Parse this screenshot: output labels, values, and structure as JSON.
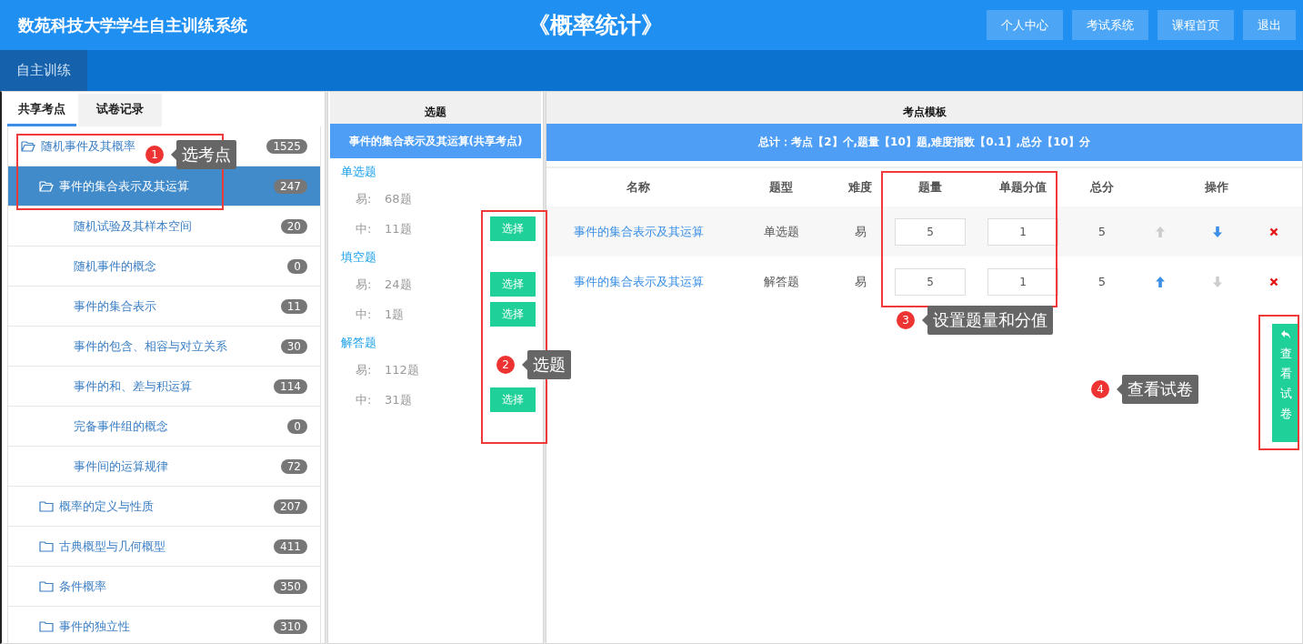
{
  "header": {
    "site_title": "数苑科技大学学生自主训练系统",
    "course_title": "《概率统计》",
    "buttons": [
      "个人中心",
      "考试系统",
      "课程首页",
      "退出"
    ]
  },
  "nav": {
    "items": [
      {
        "label": "自主训练",
        "selected": true
      }
    ]
  },
  "left_panel": {
    "tabs": [
      {
        "label": "共享考点",
        "selected": true
      },
      {
        "label": "试卷记录",
        "selected": false
      }
    ],
    "tree": [
      {
        "label": "随机事件及其概率",
        "count": "1525",
        "expanded": true,
        "selected": false,
        "children": [
          {
            "label": "事件的集合表示及其运算",
            "count": "247",
            "expanded": true,
            "selected": true,
            "children": [
              {
                "label": "随机试验及其样本空间",
                "count": "20",
                "selected": false
              },
              {
                "label": "随机事件的概念",
                "count": "0",
                "selected": false
              },
              {
                "label": "事件的集合表示",
                "count": "11",
                "selected": false
              },
              {
                "label": "事件的包含、相容与对立关系",
                "count": "30",
                "selected": false
              },
              {
                "label": "事件的和、差与积运算",
                "count": "114",
                "selected": false
              },
              {
                "label": "完备事件组的概念",
                "count": "0",
                "selected": false
              },
              {
                "label": "事件间的运算规律",
                "count": "72",
                "selected": false
              }
            ]
          },
          {
            "label": "概率的定义与性质",
            "count": "207",
            "expanded": false,
            "selected": false
          },
          {
            "label": "古典概型与几何概型",
            "count": "411",
            "expanded": false,
            "selected": false
          },
          {
            "label": "条件概率",
            "count": "350",
            "expanded": false,
            "selected": false
          },
          {
            "label": "事件的独立性",
            "count": "310",
            "expanded": false,
            "selected": false
          }
        ]
      }
    ]
  },
  "middle_panel": {
    "title": "选题",
    "subtitle": "事件的集合表示及其运算(共享考点)",
    "groups": [
      {
        "type": "单选题",
        "lines": [
          {
            "level": "易:",
            "count": "68题"
          },
          {
            "level": "中:",
            "count": "11题",
            "button": "选择"
          }
        ]
      },
      {
        "type": "填空题",
        "lines": [
          {
            "level": "易:",
            "count": "24题",
            "button": "选择"
          },
          {
            "level": "中:",
            "count": "1题",
            "button": "选择"
          }
        ]
      },
      {
        "type": "解答题",
        "lines": [
          {
            "level": "易:",
            "count": "112题"
          },
          {
            "level": "中:",
            "count": "31题",
            "button": "选择"
          }
        ]
      }
    ]
  },
  "right_panel": {
    "title": "考点模板",
    "summary": "总计：考点【2】个,题量【10】题,难度指数【0.1】,总分【10】分",
    "columns": [
      "名称",
      "题型",
      "难度",
      "题量",
      "单题分值",
      "总分",
      "操作"
    ],
    "rows": [
      {
        "name": "事件的集合表示及其运算",
        "type": "单选题",
        "difficulty": "易",
        "quantity": "5",
        "score": "1",
        "total": "5",
        "up_enabled": false,
        "down_enabled": true
      },
      {
        "name": "事件的集合表示及其运算",
        "type": "解答题",
        "difficulty": "易",
        "quantity": "5",
        "score": "1",
        "total": "5",
        "up_enabled": true,
        "down_enabled": false
      }
    ],
    "view_paper_button": "查看试卷"
  },
  "callouts": [
    {
      "number": "1",
      "text": "选考点"
    },
    {
      "number": "2",
      "text": "选题"
    },
    {
      "number": "3",
      "text": "设置题量和分值"
    },
    {
      "number": "4",
      "text": "查看试卷"
    }
  ]
}
